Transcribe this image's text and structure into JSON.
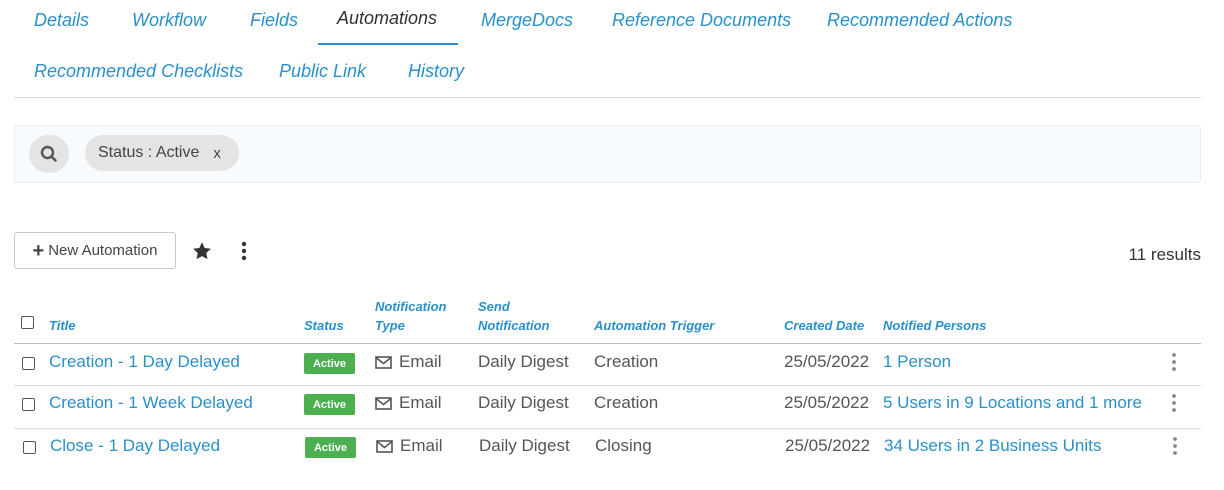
{
  "tabs": [
    {
      "label": "Details"
    },
    {
      "label": "Workflow"
    },
    {
      "label": "Fields"
    },
    {
      "label": "Automations"
    },
    {
      "label": "MergeDocs"
    },
    {
      "label": "Reference Documents"
    },
    {
      "label": "Recommended Actions"
    },
    {
      "label": "Recommended Checklists"
    },
    {
      "label": "Public Link"
    },
    {
      "label": "History"
    }
  ],
  "active_tab": "Automations",
  "filter": {
    "chip_label": "Status : Active",
    "chip_remove": "x",
    "search_icon": "search-icon"
  },
  "toolbar": {
    "new_label": "New Automation",
    "results_text": "11 results"
  },
  "table": {
    "headers": {
      "title": "Title",
      "status": "Status",
      "notification_type_1": "Notification",
      "notification_type_2": "Type",
      "send_notification_1": "Send",
      "send_notification_2": "Notification",
      "automation_trigger": "Automation Trigger",
      "created_date": "Created Date",
      "notified_persons": "Notified Persons"
    },
    "rows": [
      {
        "title": "Creation - 1 Day Delayed",
        "status": "Active",
        "notification_type": "Email",
        "send_notification": "Daily Digest",
        "trigger": "Creation",
        "created": "25/05/2022",
        "notified": "1 Person"
      },
      {
        "title": "Creation - 1 Week Delayed",
        "status": "Active",
        "notification_type": "Email",
        "send_notification": "Daily Digest",
        "trigger": "Creation",
        "created": "25/05/2022",
        "notified": "5 Users in 9 Locations and 1 more"
      },
      {
        "title": "Close - 1 Day Delayed",
        "status": "Active",
        "notification_type": "Email",
        "send_notification": "Daily Digest",
        "trigger": "Closing",
        "created": "25/05/2022",
        "notified": "34 Users in 2 Business Units"
      }
    ]
  },
  "colors": {
    "accent": "#2a90c9",
    "active_badge": "#4caf50"
  }
}
